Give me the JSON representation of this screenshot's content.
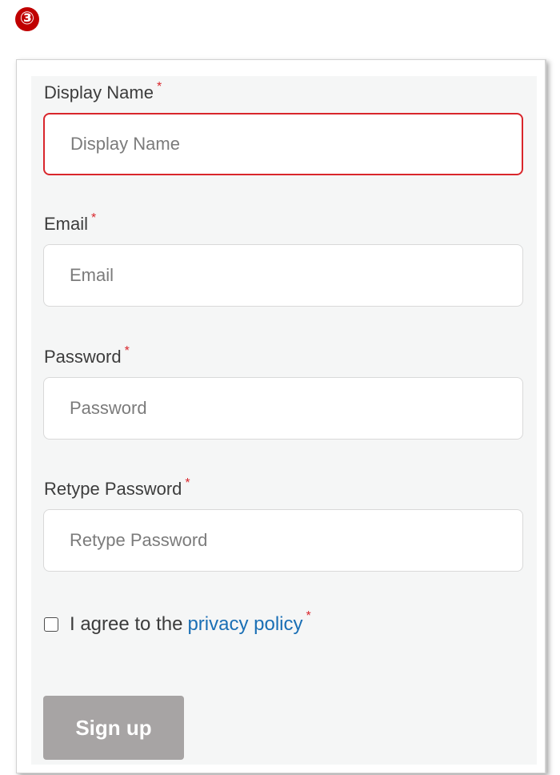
{
  "step_badge": "③",
  "form": {
    "required_marker": "*",
    "display_name": {
      "label": "Display Name",
      "placeholder": "Display Name",
      "value": ""
    },
    "email": {
      "label": "Email",
      "placeholder": "Email",
      "value": ""
    },
    "password": {
      "label": "Password",
      "placeholder": "Password",
      "value": ""
    },
    "retype_password": {
      "label": "Retype Password",
      "placeholder": "Retype Password",
      "value": ""
    },
    "agree": {
      "checked": false,
      "text": "I agree to the",
      "link_text": "privacy policy"
    },
    "submit_label": "Sign up"
  },
  "colors": {
    "badge": "#c00000",
    "required": "#d9262c",
    "error_border": "#d9262c",
    "link": "#1a6fb5",
    "button_disabled": "#a7a4a4",
    "form_background": "#f5f6f6"
  }
}
